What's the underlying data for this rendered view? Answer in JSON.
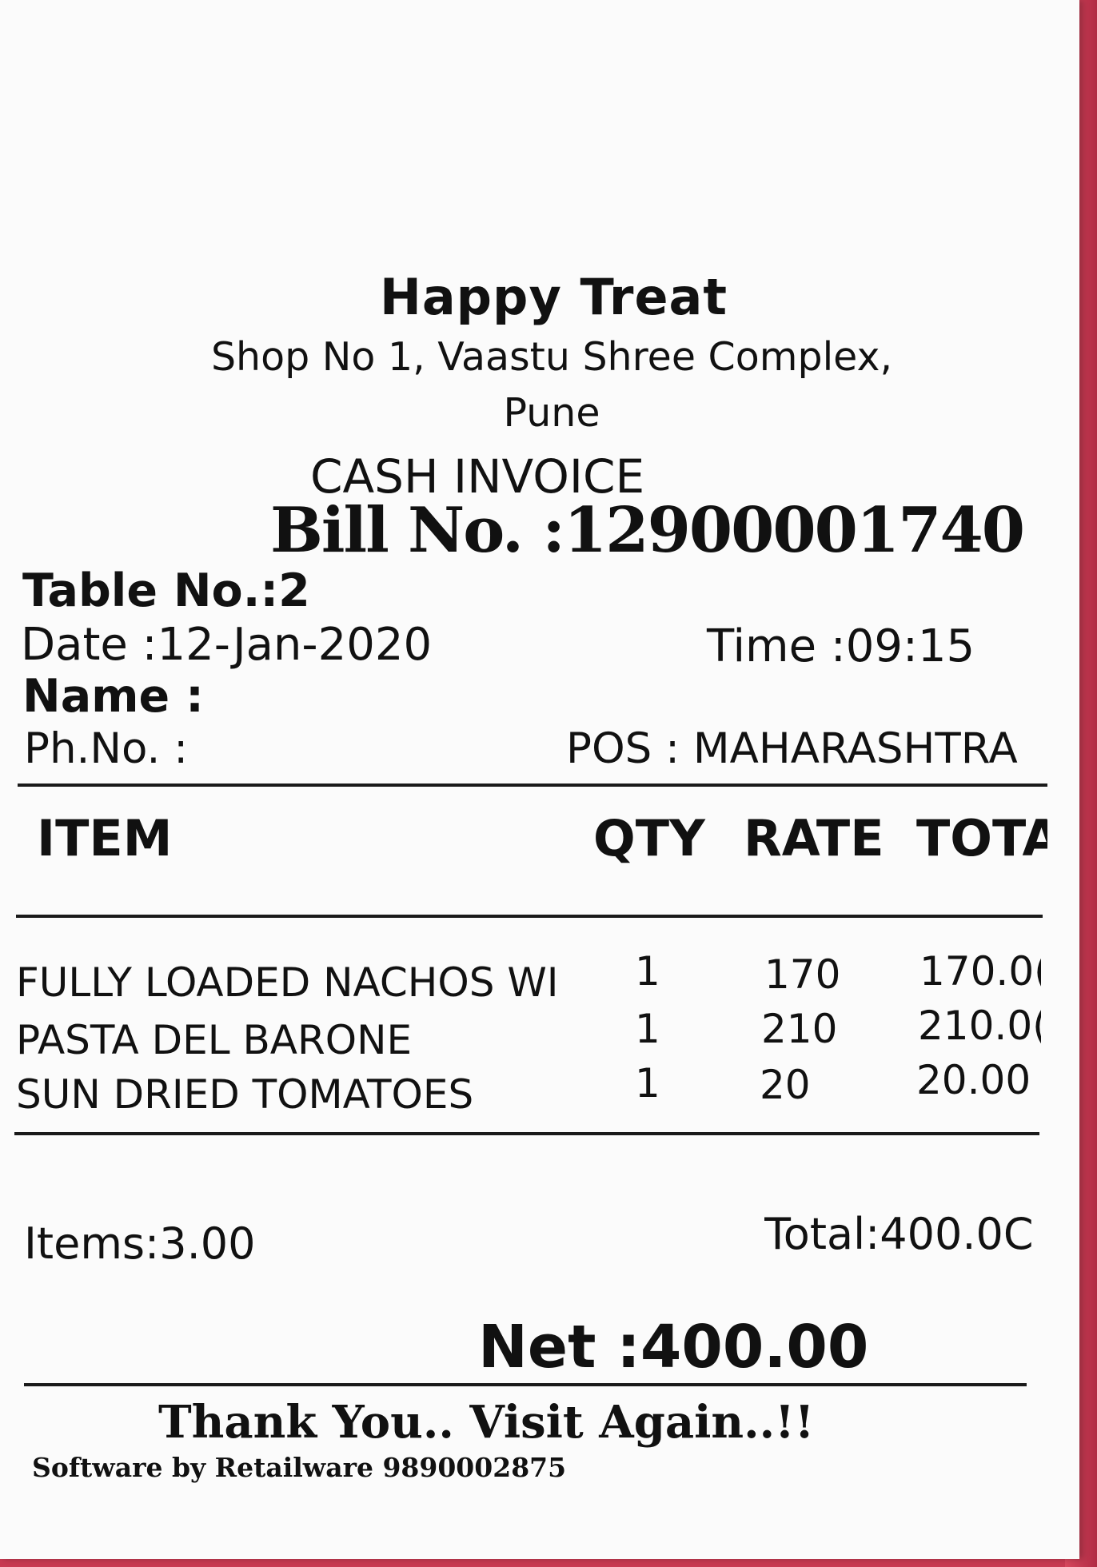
{
  "receipt": {
    "shop_name": "Happy Treat",
    "address_line1": "Shop No 1, Vaastu Shree Complex,",
    "address_line2": "Pune",
    "invoice_type": "CASH INVOICE",
    "bill_no": "Bill No. :12900001740",
    "table_no": "Table No.:2",
    "date": "Date :12-Jan-2020",
    "time": "Time :09:15",
    "name": "Name :",
    "phone": "Ph.No. :",
    "pos": "POS : MAHARASHTRA",
    "columns": {
      "item": "ITEM",
      "qty": "QTY",
      "rate": "RATE",
      "total": "TOTA"
    },
    "items": [
      {
        "name": "FULLY LOADED NACHOS WI",
        "qty": "1",
        "rate": "170",
        "total": "170.0("
      },
      {
        "name": "PASTA DEL BARONE",
        "qty": "1",
        "rate": "210",
        "total": "210.0("
      },
      {
        "name": "SUN DRIED TOMATOES",
        "qty": "1",
        "rate": "20",
        "total": "20.00"
      }
    ],
    "items_count": "Items:3.00",
    "total": "Total:400.0C",
    "net": "Net :400.00",
    "thanks": "Thank You..  Visit Again..!!",
    "software": "Software by Retailware 9890002875"
  },
  "colors": {
    "paper": "#fbfbfb",
    "background": "#c83a52",
    "ink": "#111111"
  }
}
